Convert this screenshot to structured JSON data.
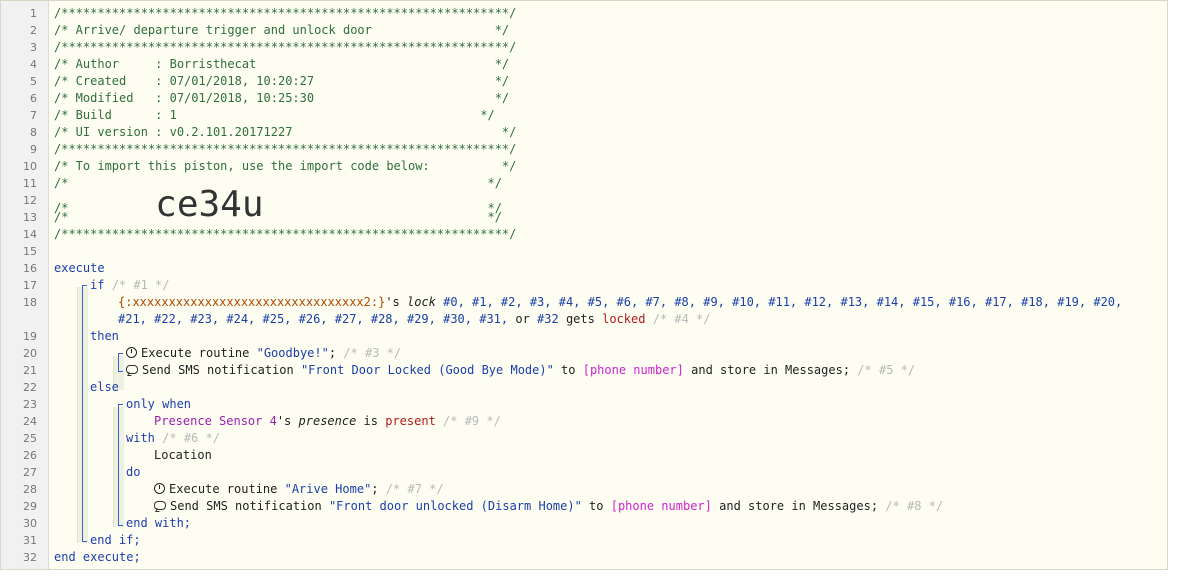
{
  "gutter": {
    "line_numbers": [
      "1",
      "2",
      "3",
      "4",
      "5",
      "6",
      "7",
      "8",
      "9",
      "10",
      "11",
      "12",
      "13",
      "14",
      "15",
      "16",
      "17",
      "18",
      "19",
      "20",
      "21",
      "22",
      "23",
      "24",
      "25",
      "26",
      "27",
      "28",
      "29",
      "30",
      "31",
      "32"
    ]
  },
  "header": {
    "border": "/**************************************************************/",
    "title_line": "/* Arrive/ departure trigger and unlock door                 */",
    "author_line": "/* Author     : Borristhecat                                 */",
    "created_line": "/* Created    : 07/01/2018, 10:20:27                         */",
    "modified_line": "/* Modified   : 07/01/2018, 10:25:30                         */",
    "build_line": "/* Build      : 1                                          */",
    "uiversion_line": "/* UI version : v0.2.101.20171227                             */",
    "import_line": "/* To import this piston, use the import code below:          */",
    "empty_line": "/*                                                          */",
    "code_prefix": "/*            ",
    "import_code": "ce34u",
    "code_suffix": "                               */"
  },
  "code": {
    "execute": "execute",
    "if": "if",
    "c1": "/* #1 */",
    "device_list": "{:xxxxxxxxxxxxxxxxxxxxxxxxxxxxxxxx2:}",
    "s_possessive": "'s ",
    "lock_attr": "lock",
    "hash_list1": " #0, #1, #2, #3, #4, #5, #6, #7, #8, #9, #10, #11, #12, #13, #14, #15, #16, #17, #18, #19, #20,",
    "hash_list2": "#21, #22, #23, #24, #25, #26, #27, #28, #29, #30, #31,",
    "or": " or ",
    "hash32": "#32",
    "gets": " gets ",
    "locked": "locked",
    "c4": "/* #4 */",
    "then": "then",
    "exec_routine": "Execute routine ",
    "goodbye": "\"Goodbye!\"",
    "semicolon": ";",
    "c3": "/* #3 */",
    "send_sms": "Send SMS notification ",
    "msg1": "\"Front Door Locked (Good Bye Mode)\"",
    "to": " to ",
    "phone": "[phone number]",
    "store": " and store in Messages;",
    "c5": "/* #5 */",
    "else": "else",
    "only_when": "only when",
    "presence_device": "Presence Sensor 4",
    "presence_attr": "presence",
    "is": " is ",
    "present": "present",
    "c9": "/* #9 */",
    "with": "with",
    "c6": "/* #6 */",
    "location": "Location",
    "do": "do",
    "arive_home": "\"Arive Home\"",
    "c7": "/* #7 */",
    "msg2": "\"Front door unlocked (Disarm Home)\"",
    "c8": "/* #8 */",
    "end_with": "end with;",
    "end_if": "end if;",
    "end_execute": "end execute;"
  }
}
